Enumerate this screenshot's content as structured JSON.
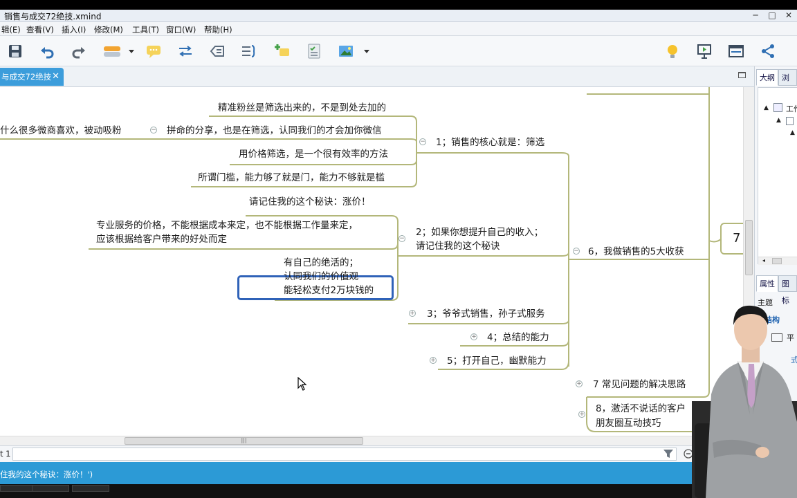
{
  "window": {
    "title": "销售与成交72绝技.xmind"
  },
  "menu": [
    "辑(E)",
    "查看(V)",
    "插入(I)",
    "修改(M)",
    "工具(T)",
    "窗口(W)",
    "帮助(H)"
  ],
  "tab": {
    "label": "与成交72绝技"
  },
  "mindmap": {
    "central_fragment": "7",
    "left_fragment": "什么很多微商喜欢，被动吸粉",
    "t1": {
      "label": "1；销售的核心就是：筛选",
      "children": [
        "精准粉丝是筛选出来的，不是到处去加的",
        "拼命的分享，也是在筛选，认同我们的才会加你微信",
        "用价格筛选，是一个很有效率的方法",
        "所谓门槛，能力够了就是门，能力不够就是槛"
      ]
    },
    "t2": {
      "label_line1": "2；如果你想提升自己的收入；",
      "label_line2": "请记住我的这个秘诀",
      "selected": "请记住我的这个秘诀：涨价！",
      "child1_line1": "专业服务的价格，不能根据成本来定，也不能根据工作量来定，",
      "child1_line2": "应该根据给客户带来的好处而定",
      "child2_line1": "有自己的绝活的；",
      "child2_line2": "认同我们的价值观",
      "child2_line3": "能轻松支付2万块钱的"
    },
    "t3": "3；爷爷式销售，孙子式服务",
    "t4": "4；总结的能力",
    "t5": "5；打开自己，幽默能力",
    "t6": "6，我做销售的5大收获",
    "t7": "7 常见问题的解决思路",
    "t8_line1": "8，激活不说话的客户",
    "t8_line2": "朋友圈互动技巧",
    "top_cut": "..."
  },
  "sidepanel": {
    "tab_outline": "大纲",
    "tab_browse": "浏览",
    "tree_item": "工作",
    "tab_props": "属性",
    "tab_icons": "图标",
    "section": "主题",
    "structure": "结构",
    "structure_val": "平",
    "style_char": "式"
  },
  "sheet": {
    "label": "t 1"
  },
  "status": {
    "text": "住我的这个秘诀：涨价！')"
  },
  "colors": {
    "accent": "#3c9ddb",
    "branch": "#b3b77a",
    "selected": "#2f62b8"
  }
}
